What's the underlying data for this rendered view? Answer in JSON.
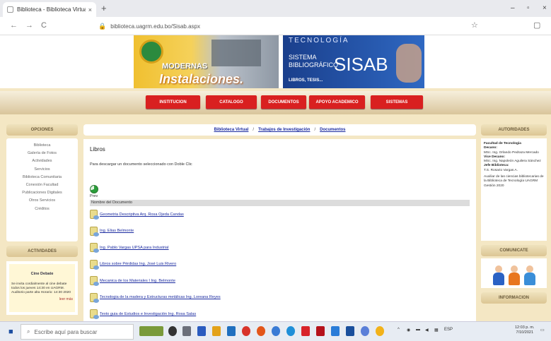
{
  "browser": {
    "tab_title": "Biblioteca - Biblioteca Virtual",
    "tab_close": "×",
    "new_tab": "+",
    "url": "biblioteca.uagrm.edu.bo/Sisab.aspx",
    "back": "←",
    "forward": "→",
    "reload": "C",
    "minimize": "–",
    "restore": "▫",
    "close": "×"
  },
  "banner": {
    "left_line1": "MODERNAS",
    "left_line2": "Instalaciones.",
    "right_top": "TECNOLOGÍA",
    "right_line1": "SISTEMA",
    "right_line2": "BIBLIOGRÁFICO",
    "right_big": "SISAB",
    "right_small": "LIBROS, TESIS..."
  },
  "menu": [
    "INSTITUCION",
    "CATALOGO",
    "DOCUMENTOS",
    "APOYO ACADEMICO",
    "SISTEMAS"
  ],
  "left": {
    "opciones_title": "OPCIONES",
    "links": [
      "Biblioteca",
      "Galería de Fotos",
      "Actividades",
      "Servicios",
      "Biblioteca Comunitaria",
      "Conexión Facultad",
      "Publicaciones Digitales",
      "Otros Servicios",
      "Créditos"
    ],
    "actividades_title": "ACTIVIDADES",
    "activity_title": "Cine Debate",
    "activity_body": "Se invita cordialmente al cine debate todos los jueves 14:30 en UAGRM. Auditorio parte alta Horario: 14:30 2020",
    "activity_more": "leer más"
  },
  "breadcrumb": {
    "item1": "Biblioteca Virtual",
    "item2": "Trabajos de Investigación",
    "item3": "Documentos",
    "sep": "/"
  },
  "main": {
    "heading": "Libros",
    "description": "Para descargar un documento seleccionado con Doble Clic",
    "prev_label": "Prev",
    "column_header": "Nombre del Documento",
    "documents": [
      "Geometria Descriptiva Arq. Rosa Ojeda Candas",
      "Ing. Elias Belmonte",
      "Ing. Pablo Vargas UPSA para Industrial",
      "Libros sobre Pérdidas Ing. José Luis Rivero",
      "Mecanica de los Materiales I Ing. Belmonte",
      "Tecnologia de la madera y Estructuras metálicas Ing. Loreana Reyes",
      "Texto guia de Estudios e Investigación Ing. Rosa Salas"
    ]
  },
  "right": {
    "autoridades_title": "AUTORIDADES",
    "lines": [
      {
        "text": "Facultad de Tecnologia",
        "bold": true
      },
      {
        "text": "Decano:",
        "bold": true
      },
      {
        "text": "MSc. Ing. Orlando Pedraza Mercado",
        "bold": false
      },
      {
        "text": "Vice Decano:",
        "bold": true
      },
      {
        "text": "MSc. Ing. Napoleón Aguilera Sánchez",
        "bold": false
      },
      {
        "text": "Jefe Biblioteca:",
        "bold": true
      },
      {
        "text": "T.S. Rosario Vargas A.",
        "bold": false
      },
      {
        "text": "",
        "bold": false
      },
      {
        "text": "Auxiliar de las ciencias bibliotecarias de la Biblioteca de Tecnología UAGRM Gestión 2020",
        "bold": false
      }
    ],
    "comunicate_title": "COMUNICATE",
    "informacion_title": "INFORMACION"
  },
  "taskbar": {
    "search_placeholder": "Escribe aquí para buscar",
    "lang": "ESP",
    "time": "12:03 p. m.",
    "date": "7/10/2021"
  },
  "colors": {
    "menu_red": "#d92020",
    "page_beige": "#f4e7c4",
    "link_blue": "#1b2ba0"
  }
}
